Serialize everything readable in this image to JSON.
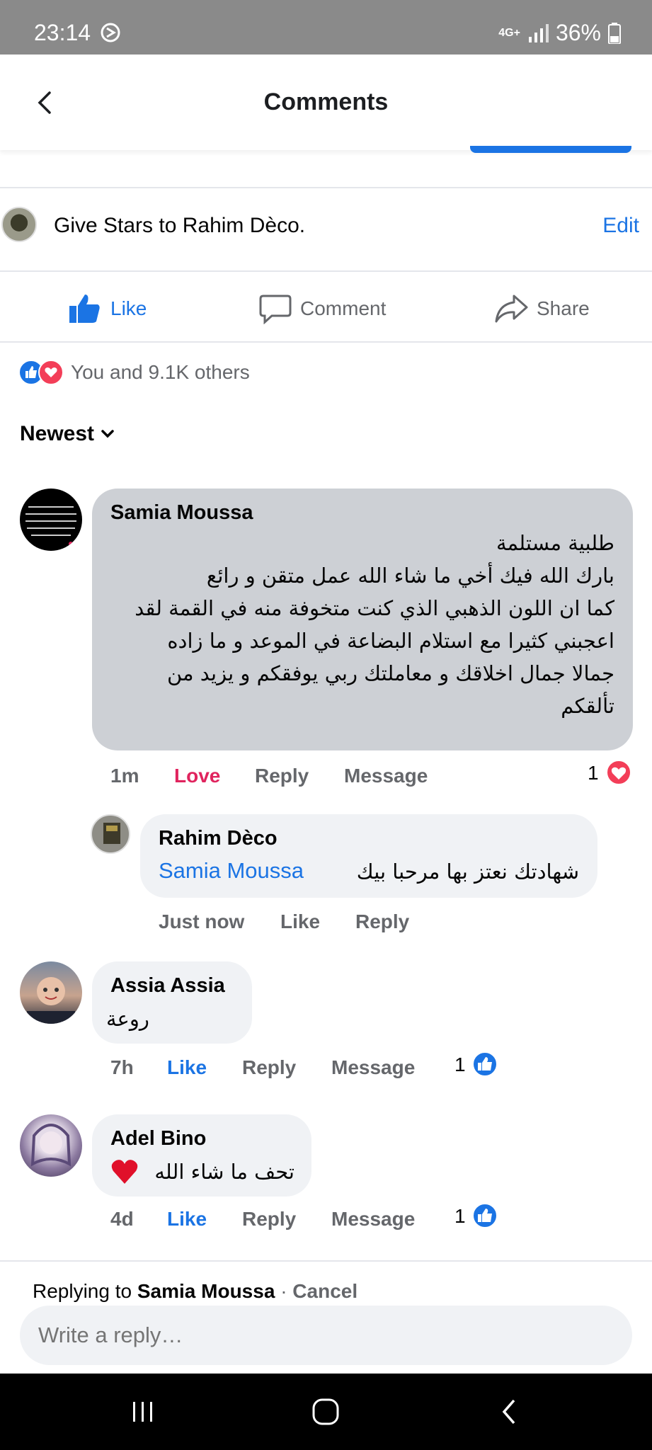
{
  "status_bar": {
    "time": "23:14",
    "network": "4G+",
    "battery": "36%"
  },
  "header": {
    "title": "Comments"
  },
  "post": {
    "text": "Give Stars to Rahim Dèco.",
    "edit_label": "Edit"
  },
  "actions": {
    "like": "Like",
    "comment": "Comment",
    "share": "Share"
  },
  "reactions": {
    "summary": "You and 9.1K others"
  },
  "sort": {
    "label": "Newest"
  },
  "comments": [
    {
      "author": "Samia Moussa",
      "text": "طلبية مستلمة\nبارك الله فيك أخي ما شاء الله عمل متقن و رائع\nكما ان اللون الذهبي الذي كنت متخوفة منه في القمة لقد\nاعجبني كثيرا مع استلام البضاعة في الموعد و ما زاده\nجمالا جمال اخلاقك و معاملتك ربي يوفقكم و يزيد من\nتألقكم",
      "time": "1m",
      "reaction_label": "Love",
      "reply": "Reply",
      "message": "Message",
      "reaction_count": "1",
      "reply_item": {
        "author": "Rahim Dèco",
        "mention": "Samia Moussa",
        "text": "شهادتك نعتز بها  مرحبا بيك",
        "time": "Just now",
        "like": "Like",
        "reply": "Reply"
      }
    },
    {
      "author": "Assia Assia",
      "text": "روعة",
      "time": "7h",
      "reaction_label": "Like",
      "reply": "Reply",
      "message": "Message",
      "reaction_count": "1"
    },
    {
      "author": "Adel Bino",
      "text": "تحف ما شاء الله",
      "time": "4d",
      "reaction_label": "Like",
      "reply": "Reply",
      "message": "Message",
      "reaction_count": "1"
    }
  ],
  "reply_box": {
    "replying_prefix": "Replying to",
    "replying_name": "Samia Moussa",
    "separator": "·",
    "cancel": "Cancel",
    "placeholder": "Write a reply…"
  },
  "colors": {
    "accent": "#1b74e4",
    "love": "#e0245e",
    "muted": "#65676b"
  }
}
